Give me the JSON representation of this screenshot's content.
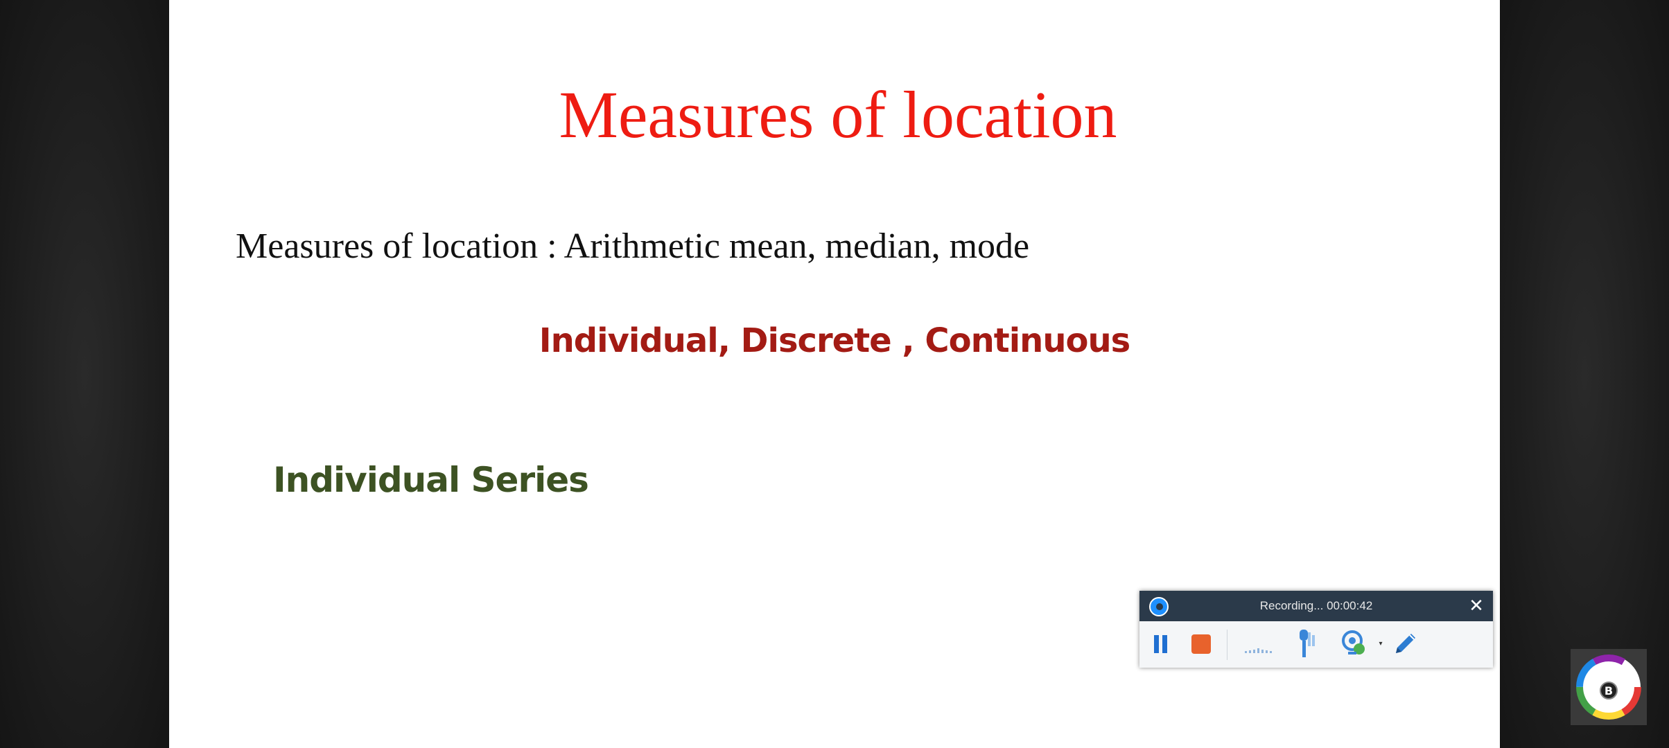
{
  "slide": {
    "title": "Measures of location",
    "subtitle": "Measures of location : Arithmetic mean, median, mode",
    "types": "Individual, Discrete , Continuous",
    "series_heading": "Individual Series"
  },
  "recorder": {
    "status": "Recording... 00:00:42",
    "close_glyph": "✕",
    "caret_glyph": "▾",
    "icons": [
      "recorder-logo-icon",
      "pause-icon",
      "stop-icon",
      "audio-level-icon",
      "microphone-icon",
      "webcam-icon",
      "pen-icon",
      "close-icon"
    ]
  },
  "colors": {
    "title": "#ee1c12",
    "types": "#a31b14",
    "series_heading": "#3d5223",
    "recorder_header": "#2b3a4a",
    "pause": "#1f6fd1",
    "stop": "#e8622c"
  },
  "watermark": {
    "letter": "B"
  }
}
